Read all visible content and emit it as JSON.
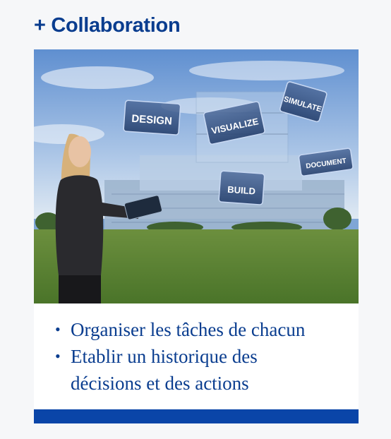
{
  "header": {
    "title": "+ Collaboration"
  },
  "hero": {
    "panels": [
      "DESIGN",
      "VISUALIZE",
      "SIMULATE",
      "DOCUMENT",
      "BUILD"
    ]
  },
  "card": {
    "bullets": [
      "Organiser les tâches de chacun",
      "Etablir un historique des",
      "décisions et des actions"
    ]
  },
  "colors": {
    "brand": "#0a3d8f",
    "bar": "#0a45a8"
  }
}
